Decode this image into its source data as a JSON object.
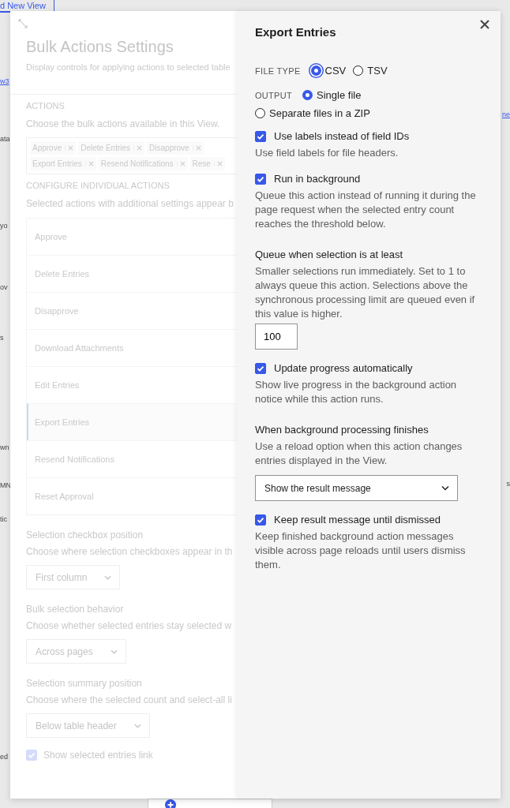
{
  "background_page": {
    "tab_link": "d New View",
    "left_fragments": [
      {
        "text": "w3",
        "kind": "link"
      },
      {
        "text": "ata",
        "kind": "text"
      },
      {
        "text": "yo",
        "kind": "text"
      },
      {
        "text": "ov",
        "kind": "text"
      },
      {
        "text": "s",
        "kind": "text"
      },
      {
        "text": "wn",
        "kind": "text"
      },
      {
        "text": "MN",
        "kind": "text"
      },
      {
        "text": "tic",
        "kind": "text"
      },
      {
        "text": "ed",
        "kind": "text"
      }
    ],
    "right_fragments": [
      {
        "text": "ne",
        "kind": "link"
      },
      {
        "text": "s",
        "kind": "text"
      }
    ]
  },
  "bulk_actions": {
    "title": "Bulk Actions Settings",
    "description": "Display controls for applying actions to selected table",
    "actions_label": "ACTIONS",
    "actions_hint": "Choose the bulk actions available in this View.",
    "tags": [
      {
        "label": "Approve"
      },
      {
        "label": "Delete Entries"
      },
      {
        "label": "Disapprove"
      },
      {
        "label": "Export Entries"
      },
      {
        "label": "Resend Notifications"
      },
      {
        "label": "Rese"
      }
    ],
    "configure_label": "CONFIGURE INDIVIDUAL ACTIONS",
    "configure_hint": "Selected actions with additional settings appear b",
    "actions": [
      {
        "label": "Approve",
        "selected": false
      },
      {
        "label": "Delete Entries",
        "selected": false
      },
      {
        "label": "Disapprove",
        "selected": false
      },
      {
        "label": "Download Attachments",
        "selected": false
      },
      {
        "label": "Edit Entries",
        "selected": false
      },
      {
        "label": "Export Entries",
        "selected": true
      },
      {
        "label": "Resend Notifications",
        "selected": false
      },
      {
        "label": "Reset Approval",
        "selected": false
      }
    ],
    "fields": [
      {
        "label": "Selection checkbox position",
        "hint": "Choose where selection checkboxes appear in th",
        "value": "First column"
      },
      {
        "label": "Bulk selection behavior",
        "hint": "Choose whether selected entries stay selected w",
        "value": "Across pages"
      },
      {
        "label": "Selection summary position",
        "hint": "Choose where the selected count and select-all li",
        "value": "Below table header"
      }
    ],
    "show_link": {
      "label": "Show selected entries link",
      "checked": true
    }
  },
  "export": {
    "title": "Export Entries",
    "file_type": {
      "label": "FILE TYPE",
      "options": [
        {
          "label": "CSV",
          "selected": true,
          "focused": true
        },
        {
          "label": "TSV",
          "selected": false,
          "focused": false
        }
      ]
    },
    "output": {
      "label": "OUTPUT",
      "options": [
        {
          "label": "Single file",
          "selected": true,
          "focused": false
        },
        {
          "label": "Separate files in a ZIP",
          "selected": false,
          "focused": false
        }
      ]
    },
    "settings": [
      {
        "kind": "checkbox",
        "label": "Use labels instead of field IDs",
        "checked": true,
        "hint": "Use field labels for file headers."
      },
      {
        "kind": "checkbox",
        "label": "Run in background",
        "checked": true,
        "hint": "Queue this action instead of running it during the page request when the selected entry count reaches the threshold below."
      },
      {
        "kind": "number",
        "label": "Queue when selection is at least",
        "hint": "Smaller selections run immediately. Set to 1 to always queue this action. Selections above the synchronous processing limit are queued even if this value is higher.",
        "value": "100"
      },
      {
        "kind": "checkbox",
        "label": "Update progress automatically",
        "checked": true,
        "hint": "Show live progress in the background action notice while this action runs."
      },
      {
        "kind": "select",
        "label": "When background processing finishes",
        "hint": "Use a reload option when this action changes entries displayed in the View.",
        "value": "Show the result message"
      },
      {
        "kind": "checkbox",
        "label": "Keep result message until dismissed",
        "checked": true,
        "hint": "Keep finished background action messages visible across page reloads until users dismiss them."
      }
    ]
  }
}
